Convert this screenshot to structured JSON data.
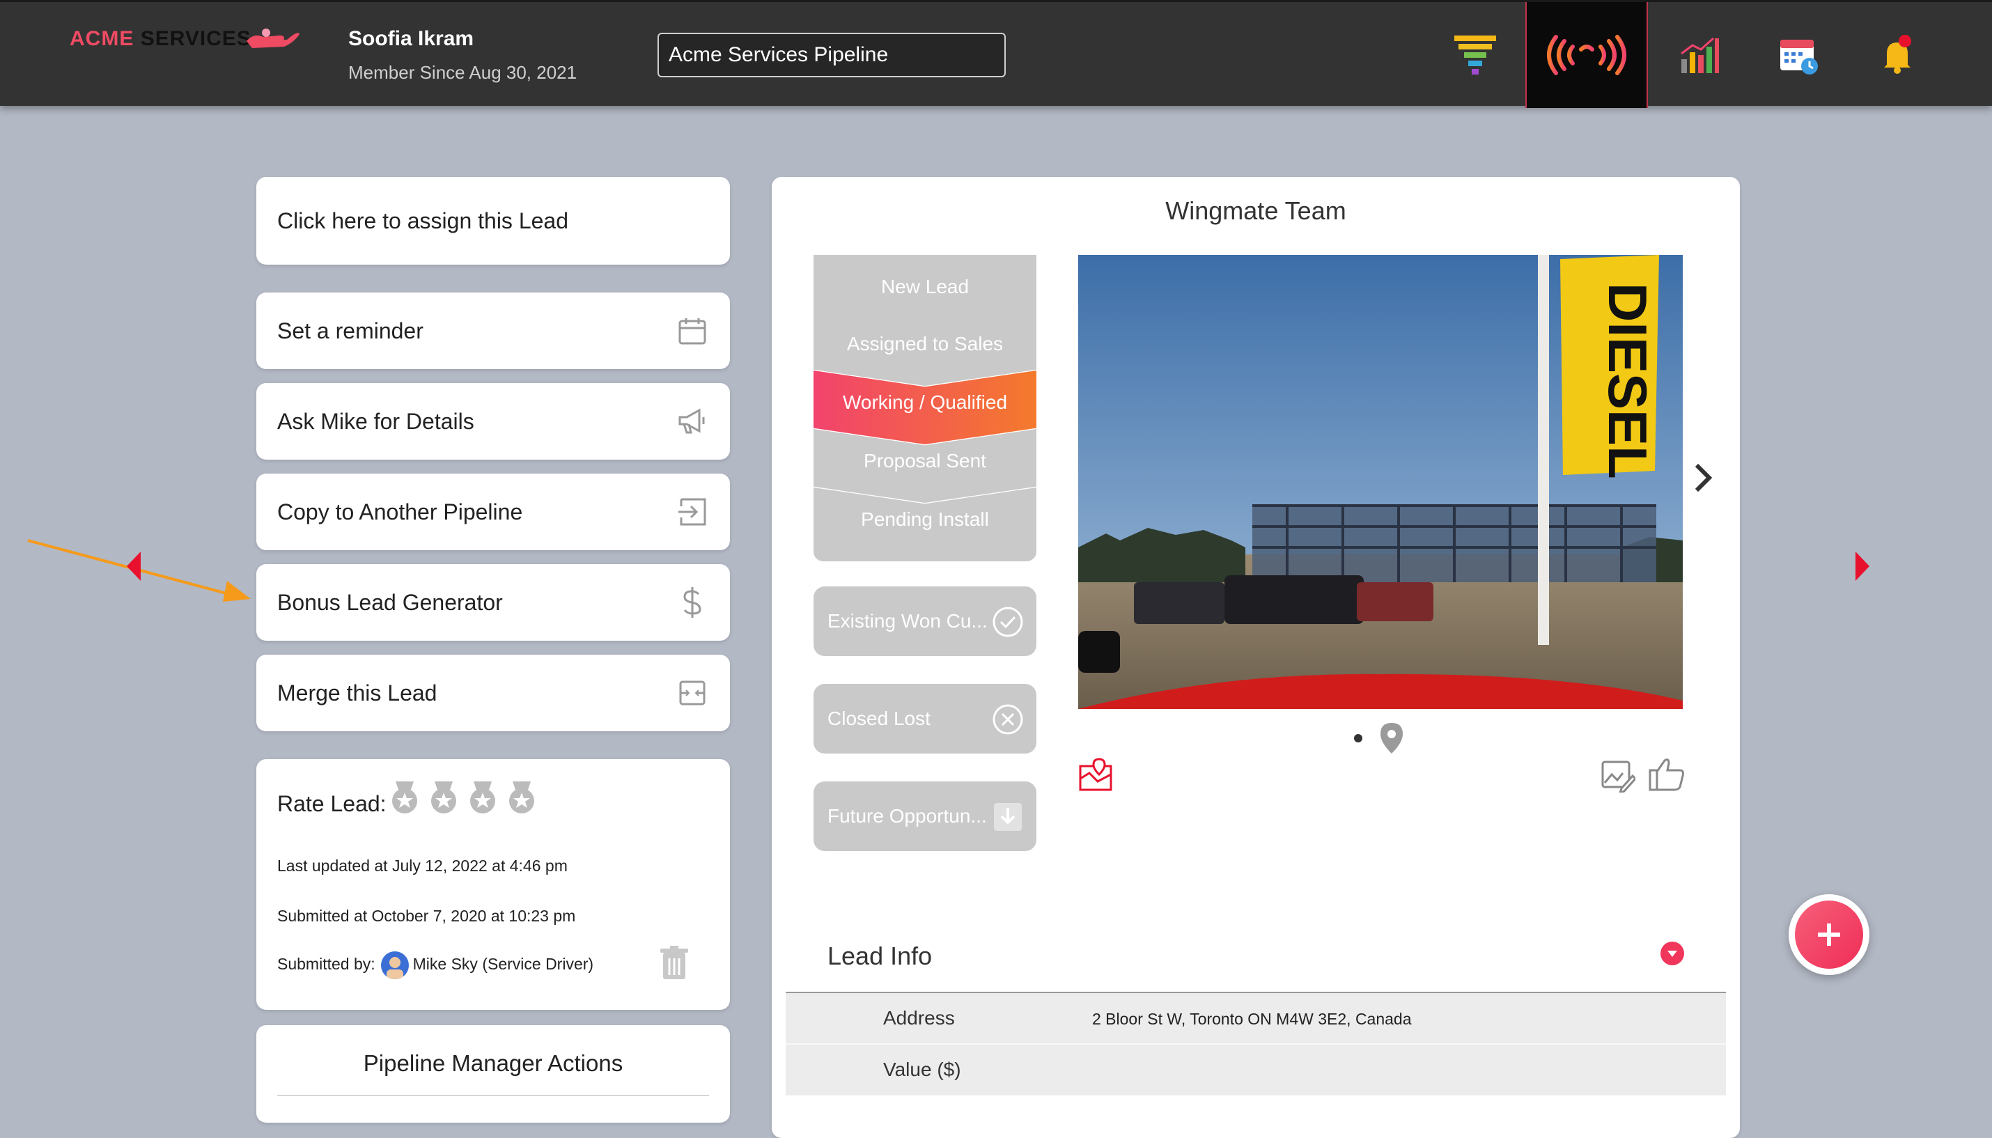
{
  "header": {
    "logo_part1": "ACME",
    "logo_part2": "SERVICES",
    "user_name": "Soofia Ikram",
    "member_since": "Member Since Aug 30, 2021",
    "pipeline": "Acme Services Pipeline",
    "nav_icons": [
      "funnel-icon",
      "broadcast-icon",
      "bar-chart-icon",
      "calendar-icon",
      "bell-icon"
    ],
    "accent_color": "#ef4b63"
  },
  "actions": {
    "assign": "Click here to assign this Lead",
    "reminder": "Set a reminder",
    "ask": "Ask Mike for Details",
    "copy": "Copy to Another Pipeline",
    "bonus": "Bonus Lead Generator",
    "merge": "Merge this Lead"
  },
  "rating": {
    "label": "Rate Lead:",
    "stars": 4,
    "last_updated": "Last updated at July 12, 2022 at 4:46 pm",
    "submitted_at": "Submitted at October 7, 2020 at 10:23 pm",
    "submitted_by_label": "Submitted by:",
    "submitted_by": "Mike Sky (Service Driver)"
  },
  "pipeline_manager": {
    "title": "Pipeline Manager Actions"
  },
  "main": {
    "team": "Wingmate Team",
    "stages": [
      "New Lead",
      "Assigned to Sales",
      "Working / Qualified",
      "Proposal Sent",
      "Pending Install"
    ],
    "active_stage": "Working / Qualified",
    "statuses": [
      "Existing Won Cu...",
      "Closed Lost",
      "Future Opportun..."
    ],
    "photo_sign": "DIESEL"
  },
  "lead_info": {
    "title": "Lead Info",
    "rows": [
      {
        "key": "Address",
        "value": "2 Bloor St W, Toronto ON M4W 3E2, Canada"
      },
      {
        "key": "Value ($)",
        "value": ""
      }
    ]
  }
}
